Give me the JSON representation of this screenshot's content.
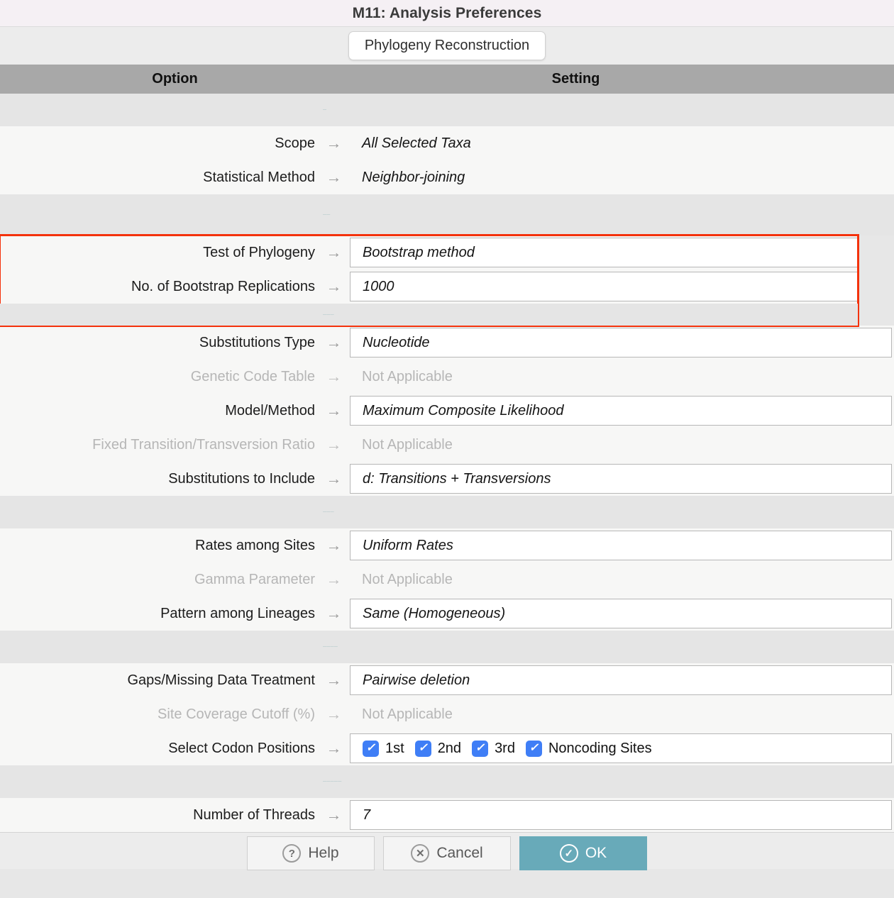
{
  "window": {
    "title": "M11: Analysis Preferences"
  },
  "tab": {
    "label": "Phylogeny Reconstruction"
  },
  "columns": {
    "option": "Option",
    "setting": "Setting"
  },
  "arrow_glyph": "→",
  "check_glyph": "✓",
  "separator_marks": {
    "s1": "—",
    "s2": "——",
    "s3": "———",
    "s4": "———",
    "s5": "————",
    "s6": "—————"
  },
  "groups": {
    "general": [
      {
        "label": "Scope",
        "value": "All Selected Taxa",
        "boxed": false,
        "disabled": false
      },
      {
        "label": "Statistical Method",
        "value": "Neighbor-joining",
        "boxed": false,
        "disabled": false
      }
    ],
    "phylogeny_test": [
      {
        "label": "Test of Phylogeny",
        "value": "Bootstrap method",
        "boxed": true,
        "disabled": false
      },
      {
        "label": "No. of Bootstrap Replications",
        "value": "1000",
        "boxed": true,
        "disabled": false
      }
    ],
    "substitution_model": [
      {
        "label": "Substitutions Type",
        "value": "Nucleotide",
        "boxed": true,
        "disabled": false
      },
      {
        "label": "Genetic Code Table",
        "value": "Not Applicable",
        "boxed": false,
        "disabled": true
      },
      {
        "label": "Model/Method",
        "value": "Maximum Composite Likelihood",
        "boxed": true,
        "disabled": false
      },
      {
        "label": "Fixed Transition/Transversion Ratio",
        "value": "Not Applicable",
        "boxed": false,
        "disabled": true
      },
      {
        "label": "Substitutions to Include",
        "value": "d: Transitions + Transversions",
        "boxed": true,
        "disabled": false
      }
    ],
    "rates_patterns": [
      {
        "label": "Rates among Sites",
        "value": "Uniform Rates",
        "boxed": true,
        "disabled": false
      },
      {
        "label": "Gamma Parameter",
        "value": "Not Applicable",
        "boxed": false,
        "disabled": true
      },
      {
        "label": "Pattern among Lineages",
        "value": "Same (Homogeneous)",
        "boxed": true,
        "disabled": false
      }
    ],
    "data_subset": [
      {
        "label": "Gaps/Missing Data Treatment",
        "value": "Pairwise deletion",
        "boxed": true,
        "disabled": false
      },
      {
        "label": "Site Coverage Cutoff (%)",
        "value": "Not Applicable",
        "boxed": false,
        "disabled": true
      }
    ],
    "codon_row_label": "Select Codon Positions",
    "codons": [
      {
        "label": "1st",
        "checked": true
      },
      {
        "label": "2nd",
        "checked": true
      },
      {
        "label": "3rd",
        "checked": true
      },
      {
        "label": "Noncoding Sites",
        "checked": true
      }
    ],
    "system_resource": [
      {
        "label": "Number of Threads",
        "value": "7",
        "boxed": true,
        "disabled": false
      }
    ]
  },
  "footer": {
    "help": {
      "label": "Help",
      "glyph": "?"
    },
    "cancel": {
      "label": "Cancel",
      "glyph": "✕"
    },
    "ok": {
      "label": "OK",
      "glyph": "✓"
    }
  },
  "colors": {
    "highlight": "#f4320c",
    "checkbox": "#3f7ef6",
    "primary_button": "#68aab9",
    "column_header": "#a8a8a8"
  }
}
